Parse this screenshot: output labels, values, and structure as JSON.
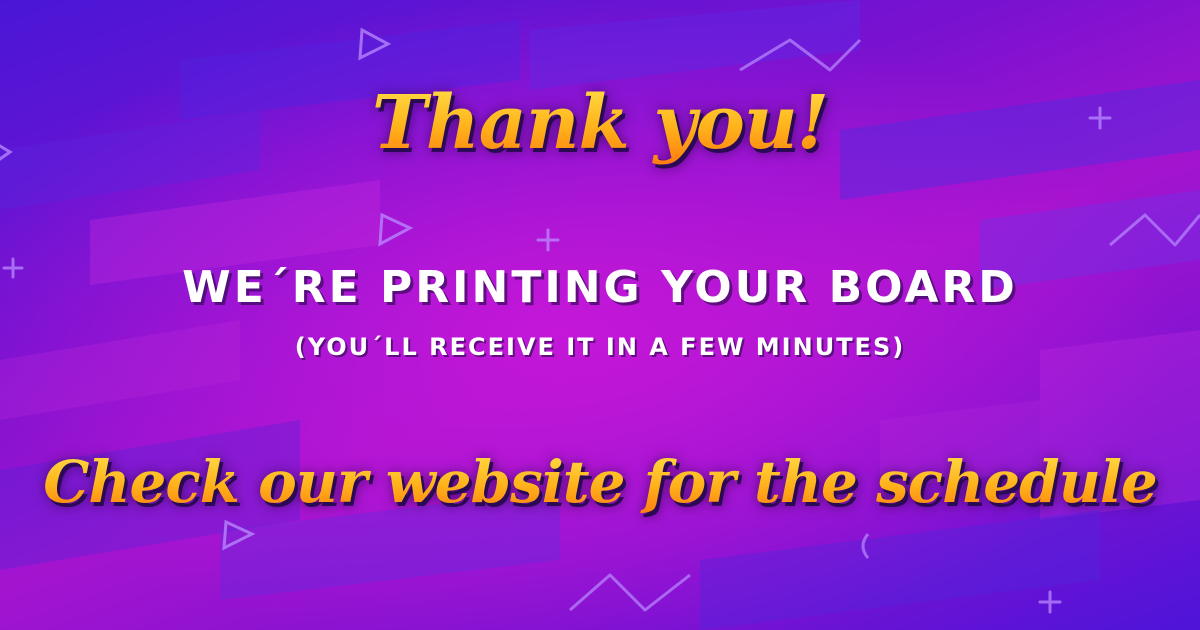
{
  "colors": {
    "background_primary": "#7a12d0",
    "background_glow": "#c417d8",
    "heading_gradient_top": "#ffe14a",
    "heading_gradient_bottom": "#ff7a10",
    "body_text": "#ffffff"
  },
  "decorations": [
    "triangle-outline",
    "plus-mark",
    "zigzag-line",
    "diagonal-stripe"
  ],
  "headline": "Thank you!",
  "status_message": "We´re printing your board",
  "status_detail": "(You´ll receive it in a few minutes)",
  "call_to_action": "Check our website for the schedule"
}
